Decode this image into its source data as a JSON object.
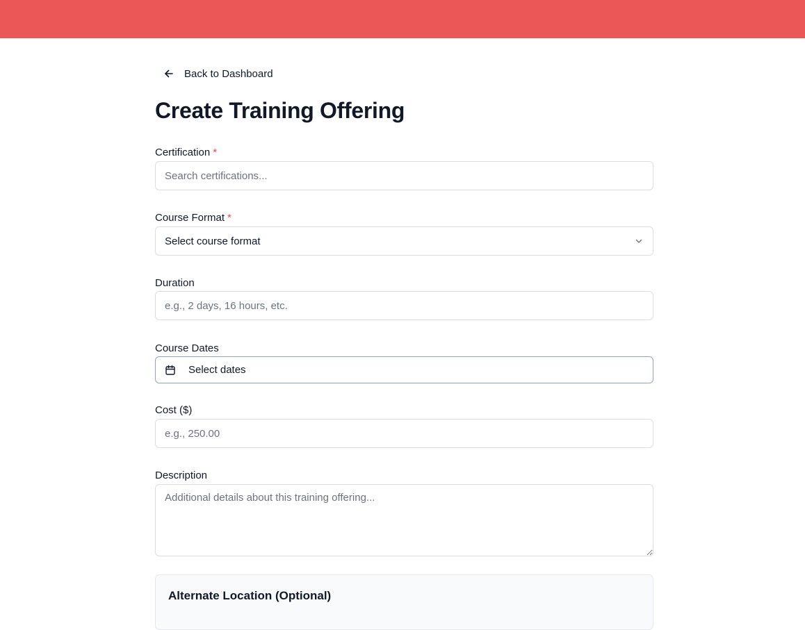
{
  "colors": {
    "top_bar": "#eb5757",
    "required_marker": "#ef4444",
    "title": "#111827",
    "text": "#0f172a",
    "placeholder": "#6b7280",
    "border": "#d8dde6"
  },
  "nav": {
    "back_label": "Back to Dashboard",
    "back_icon": "arrow-left-icon"
  },
  "page": {
    "title": "Create Training Offering"
  },
  "form": {
    "certification": {
      "label": "Certification",
      "required_mark": "*",
      "value": "",
      "placeholder": "Search certifications..."
    },
    "course_format": {
      "label": "Course Format",
      "required_mark": "*",
      "selected": "Select course format",
      "icon": "chevron-down-icon"
    },
    "duration": {
      "label": "Duration",
      "value": "",
      "placeholder": "e.g., 2 days, 16 hours, etc."
    },
    "course_dates": {
      "label": "Course Dates",
      "button_text": "Select dates",
      "icon": "calendar-icon"
    },
    "cost": {
      "label": "Cost ($)",
      "value": "",
      "placeholder": "e.g., 250.00"
    },
    "description": {
      "label": "Description",
      "value": "",
      "placeholder": "Additional details about this training offering..."
    },
    "alternate_location": {
      "title": "Alternate Location (Optional)"
    }
  }
}
